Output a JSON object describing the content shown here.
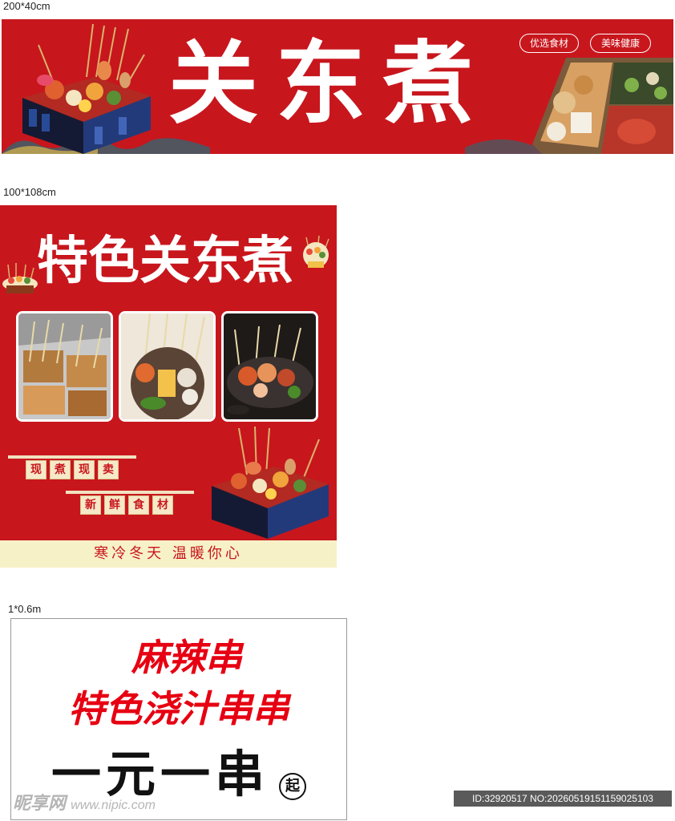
{
  "labels": {
    "banner1_size": "200*40cm",
    "poster2_size": "100*108cm",
    "sign3_size": "1*0.6m"
  },
  "banner1": {
    "title": "关东煮",
    "tag1": "优选食材",
    "tag2": "美味健康"
  },
  "poster2": {
    "title": "特色关东煮",
    "tag_line1": [
      "现",
      "煮",
      "现",
      "卖"
    ],
    "tag_line2": [
      "新",
      "鲜",
      "食",
      "材"
    ],
    "footer": "寒冷冬天  温暖你心"
  },
  "sign3": {
    "line1": "麻辣串",
    "line2": "特色浇汁串串",
    "line3": "一元一串",
    "badge": "起"
  },
  "watermark": {
    "site_cn": "昵享网",
    "site_url": "www.nipic.com",
    "id_text": "ID:32920517 NO:20260519151159025103"
  },
  "colors": {
    "brand_red": "#c8161d",
    "sign_red": "#e60012",
    "cream": "#f7f1c8"
  }
}
